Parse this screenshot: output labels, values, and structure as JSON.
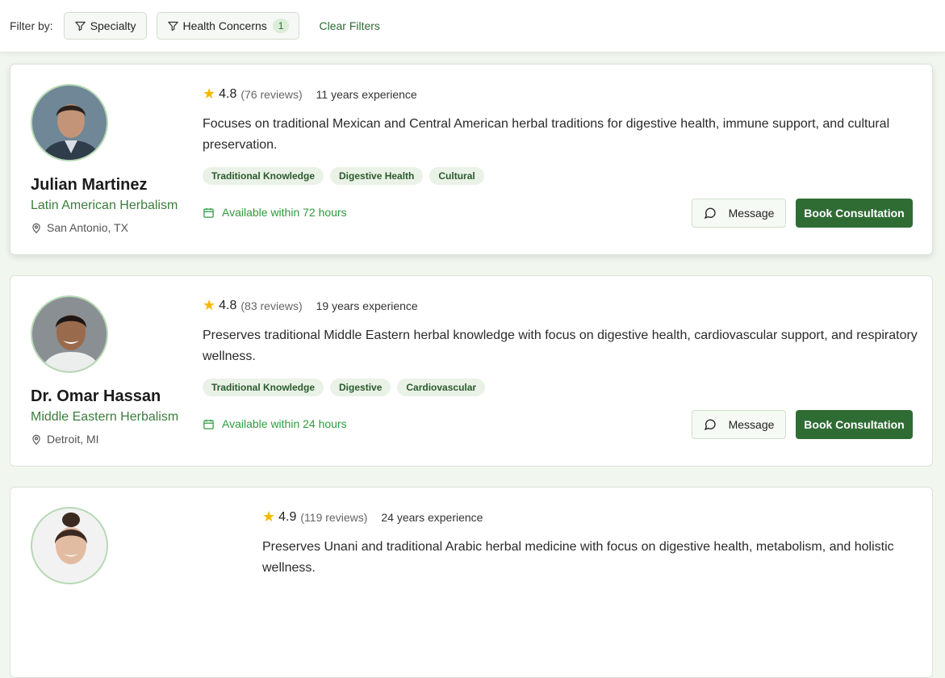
{
  "filters": {
    "label": "Filter by:",
    "specialty_label": "Specialty",
    "health_concerns_label": "Health Concerns",
    "health_concerns_count": "1",
    "clear_label": "Clear Filters"
  },
  "practitioners": [
    {
      "name": "Julian Martinez",
      "specialty": "Latin American Herbalism",
      "location": "San Antonio, TX",
      "rating": "4.8",
      "reviews": "(76 reviews)",
      "experience": "11 years experience",
      "description": "Focuses on traditional Mexican and Central American herbal traditions for digestive health, immune support, and cultural preservation.",
      "tags": [
        "Traditional Knowledge",
        "Digestive Health",
        "Cultural"
      ],
      "availability": "Available within 72 hours",
      "message_label": "Message",
      "book_label": "Book Consultation"
    },
    {
      "name": "Dr. Omar Hassan",
      "specialty": "Middle Eastern Herbalism",
      "location": "Detroit, MI",
      "rating": "4.8",
      "reviews": "(83 reviews)",
      "experience": "19 years experience",
      "description": "Preserves traditional Middle Eastern herbal knowledge with focus on digestive health, cardiovascular support, and respiratory wellness.",
      "tags": [
        "Traditional Knowledge",
        "Digestive",
        "Cardiovascular"
      ],
      "availability": "Available within 24 hours",
      "message_label": "Message",
      "book_label": "Book Consultation"
    },
    {
      "rating": "4.9",
      "reviews": "(119 reviews)",
      "experience": "24 years experience",
      "description": "Preserves Unani and traditional Arabic herbal medicine with focus on digestive health, metabolism, and holistic wellness."
    }
  ],
  "colors": {
    "accent": "#2f6c34",
    "availability": "#2f9a3f",
    "star": "#f5b800"
  },
  "icons": [
    "filter-icon",
    "map-pin-icon",
    "calendar-icon",
    "message-circle-icon",
    "star-icon"
  ]
}
